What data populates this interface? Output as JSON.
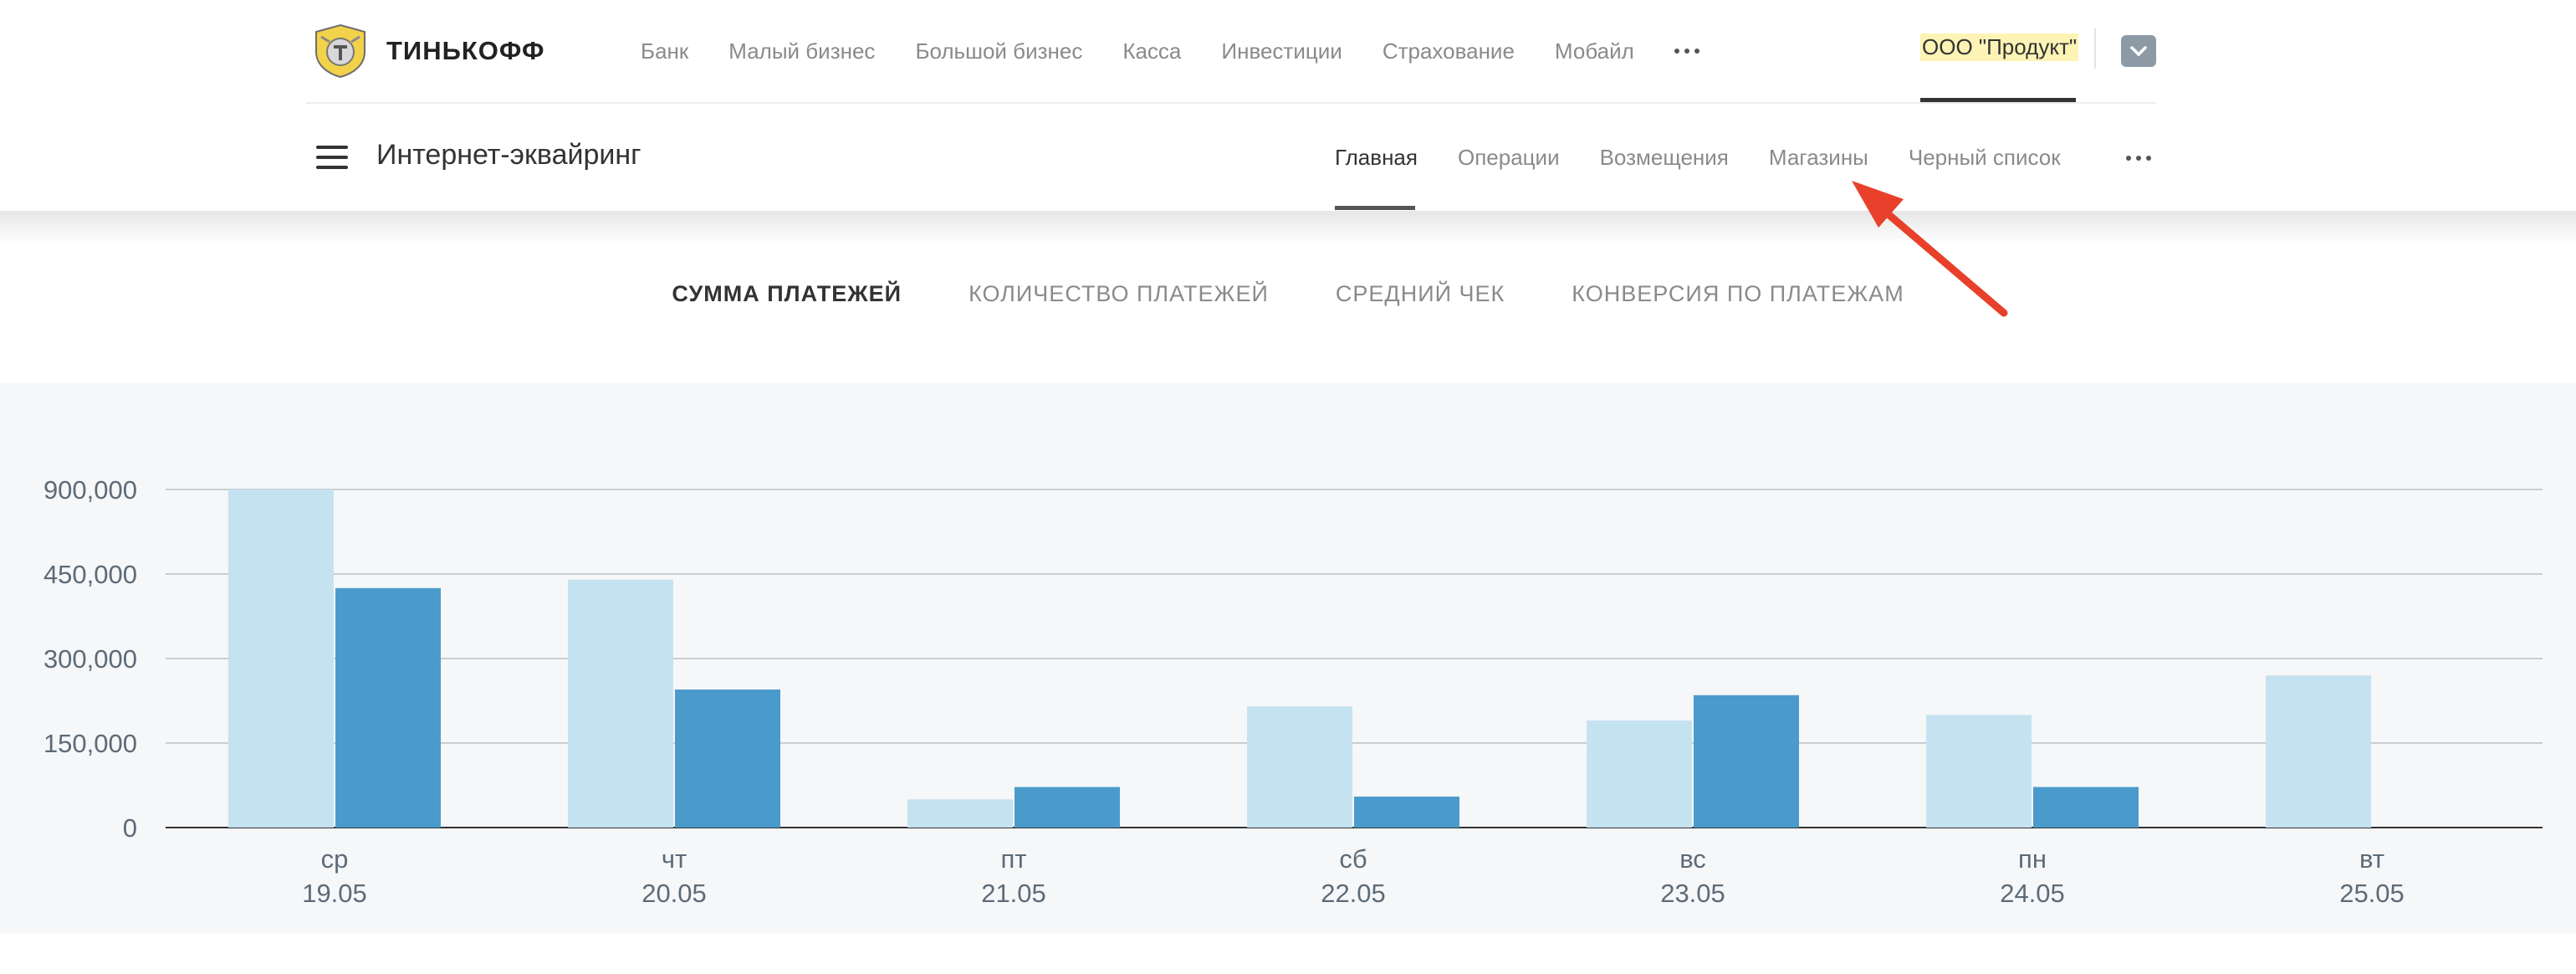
{
  "brand": {
    "logo_text": "ТИНЬКОФФ"
  },
  "top_nav": {
    "items": [
      "Банк",
      "Малый бизнес",
      "Большой бизнес",
      "Касса",
      "Инвестиции",
      "Страхование",
      "Мобайл"
    ],
    "more_icon": "more-dots-icon",
    "company_name": "ООО \"Продукт\"",
    "account_icon": "chevron-down-icon"
  },
  "sub_nav": {
    "title": "Интернет-эквайринг",
    "menu_icon": "hamburger-icon",
    "items": [
      "Главная",
      "Операции",
      "Возмещения",
      "Магазины",
      "Черный список"
    ],
    "active": "Главная",
    "more_icon": "more-dots-icon"
  },
  "metric_tabs": {
    "items": [
      "СУММА ПЛАТЕЖЕЙ",
      "КОЛИЧЕСТВО ПЛАТЕЖЕЙ",
      "СРЕДНИЙ ЧЕК",
      "КОНВЕРСИЯ ПО ПЛАТЕЖАМ"
    ],
    "active": "СУММА ПЛАТЕЖЕЙ"
  },
  "colors": {
    "series_light": "#c5e2f1",
    "series_dark": "#4a9bcb",
    "arrow": "#e8402a",
    "gridline": "#c9ced3",
    "axis": "#333333"
  },
  "annotation": {
    "type": "arrow",
    "points_to": "Магазины"
  },
  "chart_data": {
    "type": "bar",
    "categories": [
      "ср",
      "чт",
      "пт",
      "сб",
      "вс",
      "пн",
      "вт"
    ],
    "dates": [
      "19.05",
      "20.05",
      "21.05",
      "22.05",
      "23.05",
      "24.05",
      "25.05"
    ],
    "y_ticks": [
      0,
      150000,
      300000,
      450000,
      900000
    ],
    "y_tick_labels": [
      "0",
      "150,000",
      "300,000",
      "450,000",
      "900,000"
    ],
    "y_scale": "piecewise: equal spacing between listed ticks",
    "series": [
      {
        "color": "#c5e2f1",
        "values": [
          900000,
          440000,
          50000,
          215000,
          190000,
          200000,
          270000
        ]
      },
      {
        "color": "#4a9bcb",
        "values": [
          425000,
          245000,
          72000,
          55000,
          235000,
          72000,
          null
        ]
      }
    ],
    "grid": true,
    "title": "",
    "xlabel": "",
    "ylabel": ""
  }
}
